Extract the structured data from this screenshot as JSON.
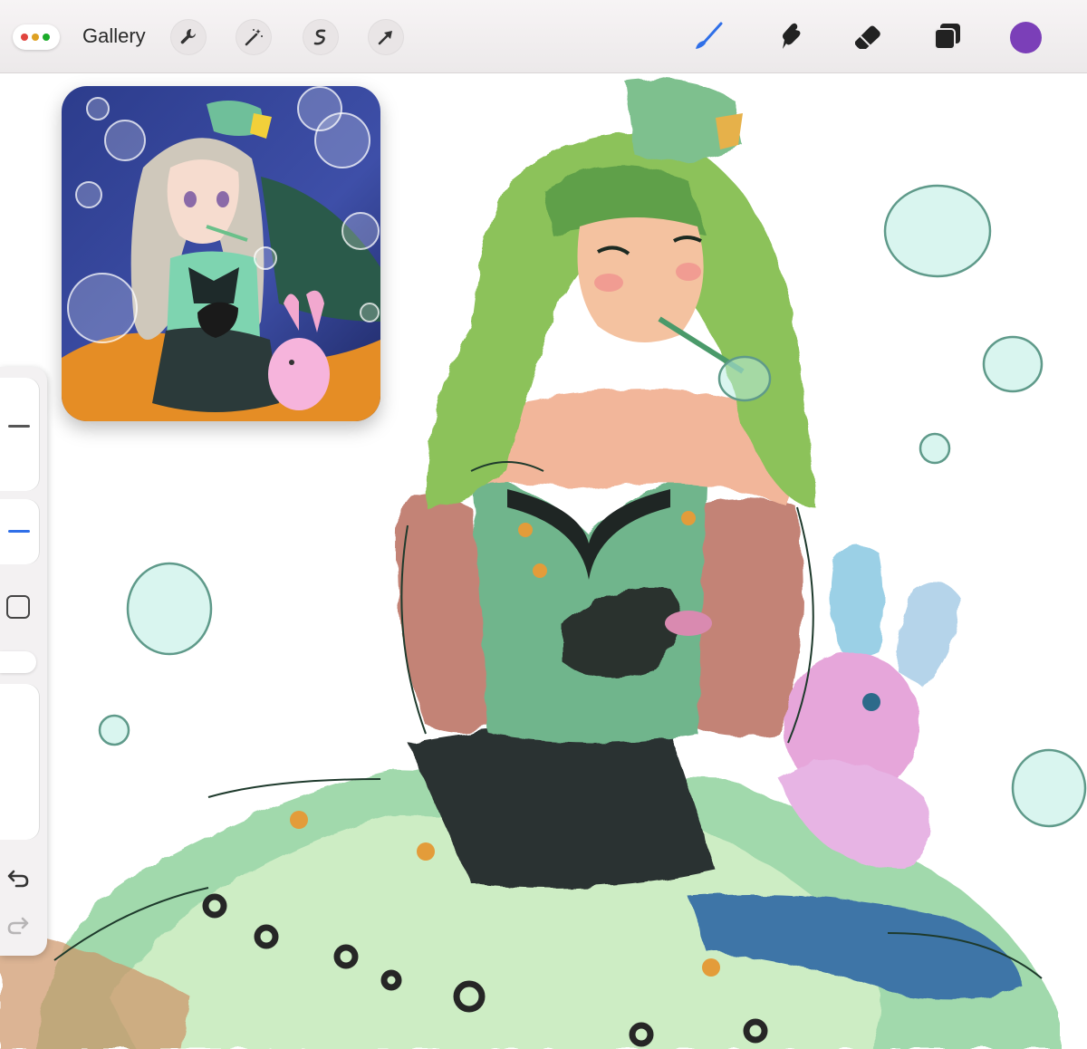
{
  "toolbar": {
    "gallery_label": "Gallery",
    "left_tools": [
      {
        "name": "actions",
        "icon": "wrench-icon"
      },
      {
        "name": "adjustments",
        "icon": "magic-wand-icon"
      },
      {
        "name": "selection",
        "icon": "selection-s-icon"
      },
      {
        "name": "transform",
        "icon": "arrow-cursor-icon"
      }
    ],
    "right_tools": [
      {
        "name": "brush",
        "icon": "brush-icon",
        "active": true
      },
      {
        "name": "smudge",
        "icon": "smudge-icon"
      },
      {
        "name": "eraser",
        "icon": "eraser-icon"
      },
      {
        "name": "layers",
        "icon": "layers-icon"
      }
    ],
    "current_color": "#7b3fb8"
  },
  "reference": {
    "icon": "reference-image"
  },
  "sidebar": {
    "brush_size": 0.58,
    "brush_opacity": 0.45,
    "icons": [
      "modify-square-icon",
      "undo-icon",
      "redo-icon"
    ],
    "active_color": "#2f6fe8"
  },
  "window_controls": {
    "colors": [
      "#e0443e",
      "#dea123",
      "#1aab29"
    ]
  }
}
